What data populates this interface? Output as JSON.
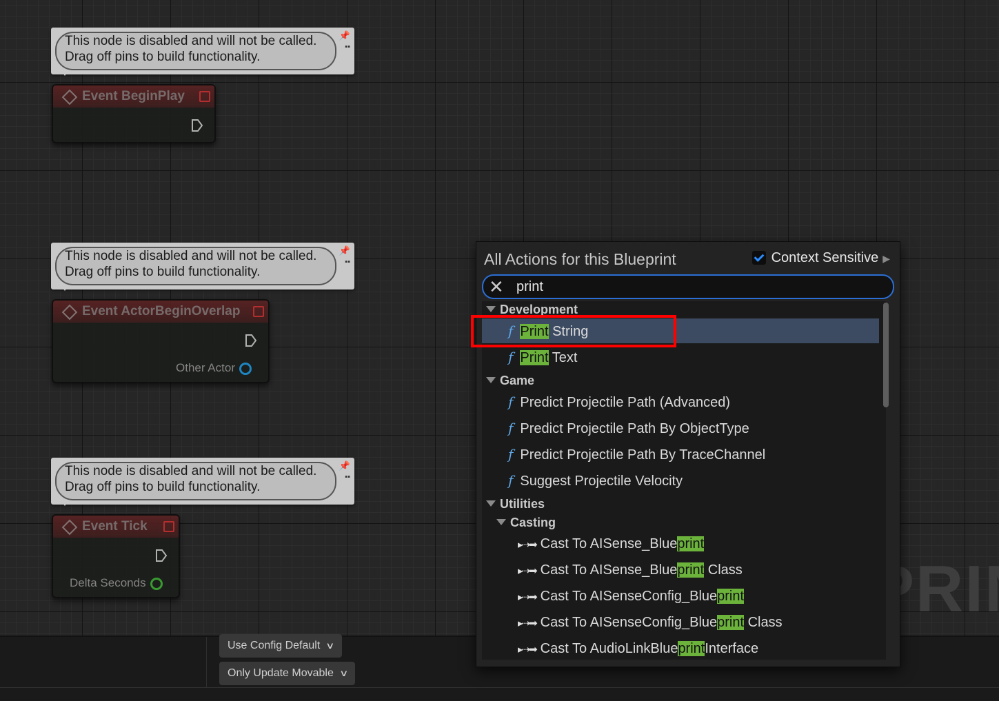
{
  "graph": {
    "watermark": "PRIN",
    "comment_line1": "This node is disabled and will not be called.",
    "comment_line2": "Drag off pins to build functionality.",
    "nodes": [
      {
        "title": "Event BeginPlay"
      },
      {
        "title": "Event ActorBeginOverlap",
        "pin_label": "Other Actor"
      },
      {
        "title": "Event Tick",
        "pin_label": "Delta Seconds"
      }
    ]
  },
  "bottom": {
    "dropdown1": "Use Config Default",
    "dropdown2": "Only Update Movable"
  },
  "menu": {
    "title": "All Actions for this Blueprint",
    "context_label": "Context Sensitive",
    "context_checked": true,
    "search_value": "print",
    "categories": {
      "development": "Development",
      "game": "Game",
      "utilities": "Utilities",
      "casting": "Casting"
    },
    "dev_items": [
      {
        "hl": "Print",
        "rest": " String"
      },
      {
        "hl": "Print",
        "rest": " Text"
      }
    ],
    "game_items": [
      "Predict Projectile Path (Advanced)",
      "Predict Projectile Path By ObjectType",
      "Predict Projectile Path By TraceChannel",
      "Suggest Projectile Velocity"
    ],
    "cast_items": [
      {
        "pre": "Cast To AISense_Blue",
        "hl": "print",
        "post": ""
      },
      {
        "pre": "Cast To AISense_Blue",
        "hl": "print",
        "post": " Class"
      },
      {
        "pre": "Cast To AISenseConfig_Blue",
        "hl": "print",
        "post": ""
      },
      {
        "pre": "Cast To AISenseConfig_Blue",
        "hl": "print",
        "post": " Class"
      },
      {
        "pre": "Cast To AudioLinkBlue",
        "hl": "print",
        "post": "Interface"
      }
    ],
    "colors": {
      "accent": "#2b6fd6",
      "highlight": "#6cb33c",
      "selected_row": "#3c4b62",
      "annotation": "#ff0000"
    }
  }
}
